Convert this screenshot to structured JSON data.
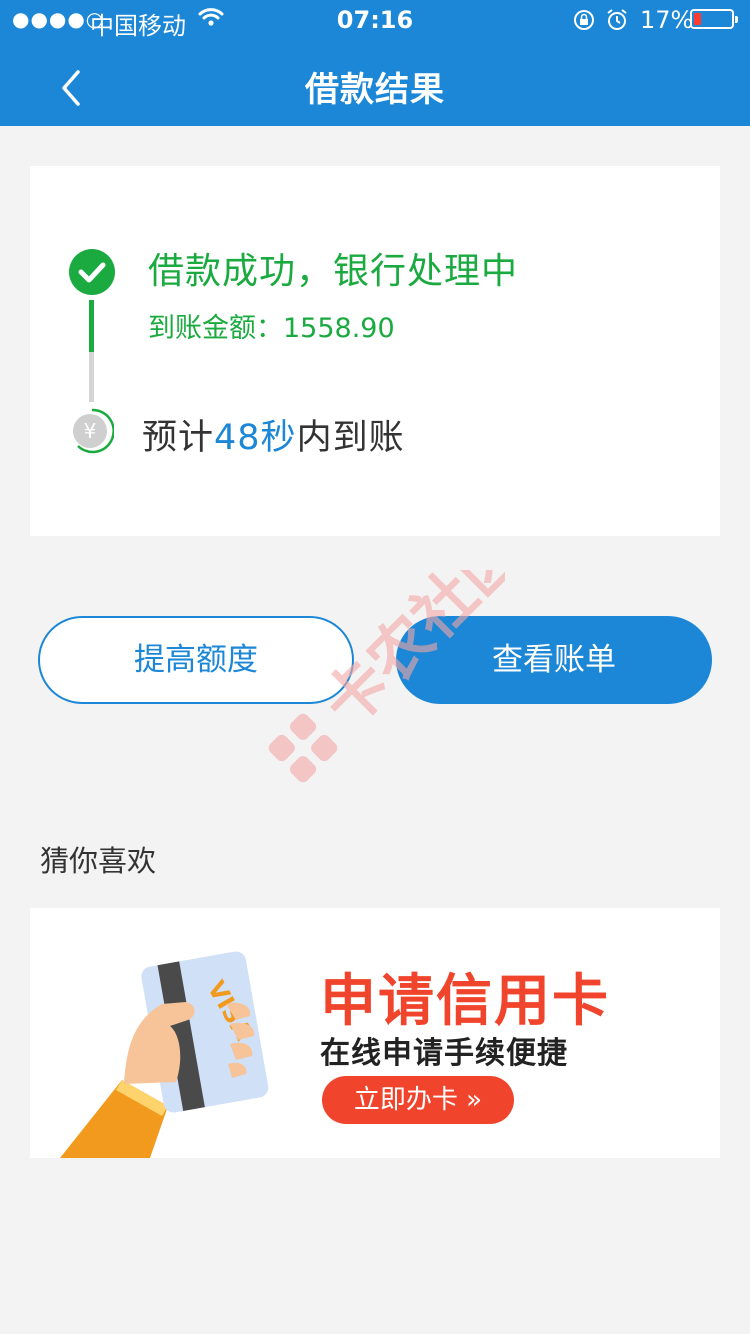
{
  "status_bar": {
    "signal": "●●●●○",
    "carrier": "中国移动",
    "time": "07:16",
    "battery": "17%"
  },
  "nav": {
    "title": "借款结果",
    "back_icon": "chevron-left-icon"
  },
  "result": {
    "status_title": "借款成功，银行处理中",
    "amount_label": "到账金额：1558.90",
    "expect_prefix": "预计",
    "expect_time": "48秒",
    "expect_suffix": "内到账"
  },
  "actions": {
    "raise_limit": "提高额度",
    "view_bill": "查看账单"
  },
  "watermark": "卡农社区",
  "recommend": {
    "section_label": "猜你喜欢",
    "banner_title": "申请信用卡",
    "banner_subtitle": "在线申请手续便捷",
    "banner_button": "立即办卡",
    "card_brand": "VISA"
  },
  "colors": {
    "primary": "#1b87d6",
    "success": "#1aaa3f",
    "accent": "#f0452c",
    "background": "#f3f3f3"
  }
}
